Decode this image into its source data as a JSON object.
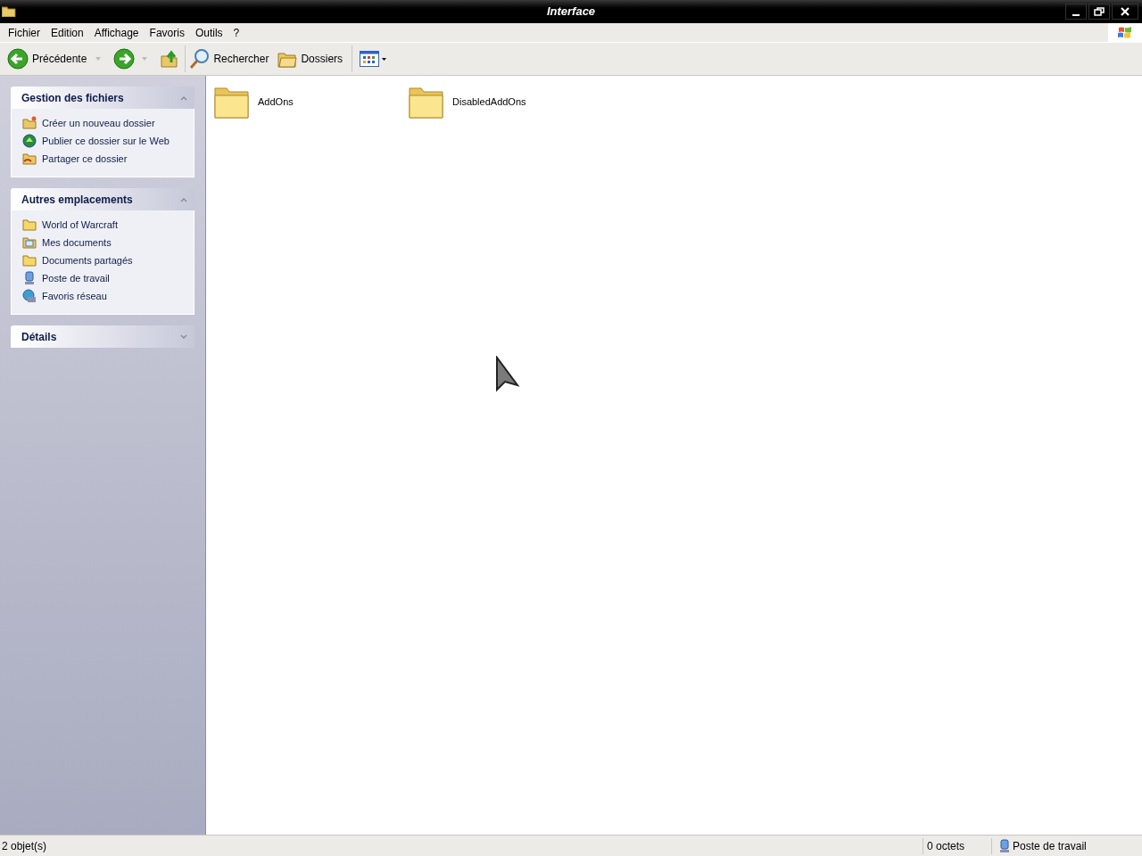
{
  "window": {
    "title": "Interface"
  },
  "menu": [
    "Fichier",
    "Edition",
    "Affichage",
    "Favoris",
    "Outils",
    "?"
  ],
  "toolbar": {
    "back": "Précédente",
    "search": "Rechercher",
    "folders": "Dossiers"
  },
  "panels": [
    {
      "title": "Gestion des fichiers",
      "expanded": true,
      "items": [
        {
          "label": "Créer un nouveau dossier",
          "kind": "newfolder"
        },
        {
          "label": "Publier ce dossier sur le Web",
          "kind": "publish"
        },
        {
          "label": "Partager ce dossier",
          "kind": "share"
        }
      ]
    },
    {
      "title": "Autres emplacements",
      "expanded": true,
      "items": [
        {
          "label": "World of Warcraft",
          "kind": "folder"
        },
        {
          "label": "Mes documents",
          "kind": "documents"
        },
        {
          "label": "Documents partagés",
          "kind": "folder"
        },
        {
          "label": "Poste de travail",
          "kind": "computer"
        },
        {
          "label": "Favoris réseau",
          "kind": "network"
        }
      ]
    },
    {
      "title": "Détails",
      "expanded": false
    }
  ],
  "files": [
    {
      "name": "AddOns"
    },
    {
      "name": "DisabledAddOns"
    }
  ],
  "status_bar": {
    "count": "2 objet(s)",
    "size": "0 octets",
    "location": "Poste de travail"
  }
}
